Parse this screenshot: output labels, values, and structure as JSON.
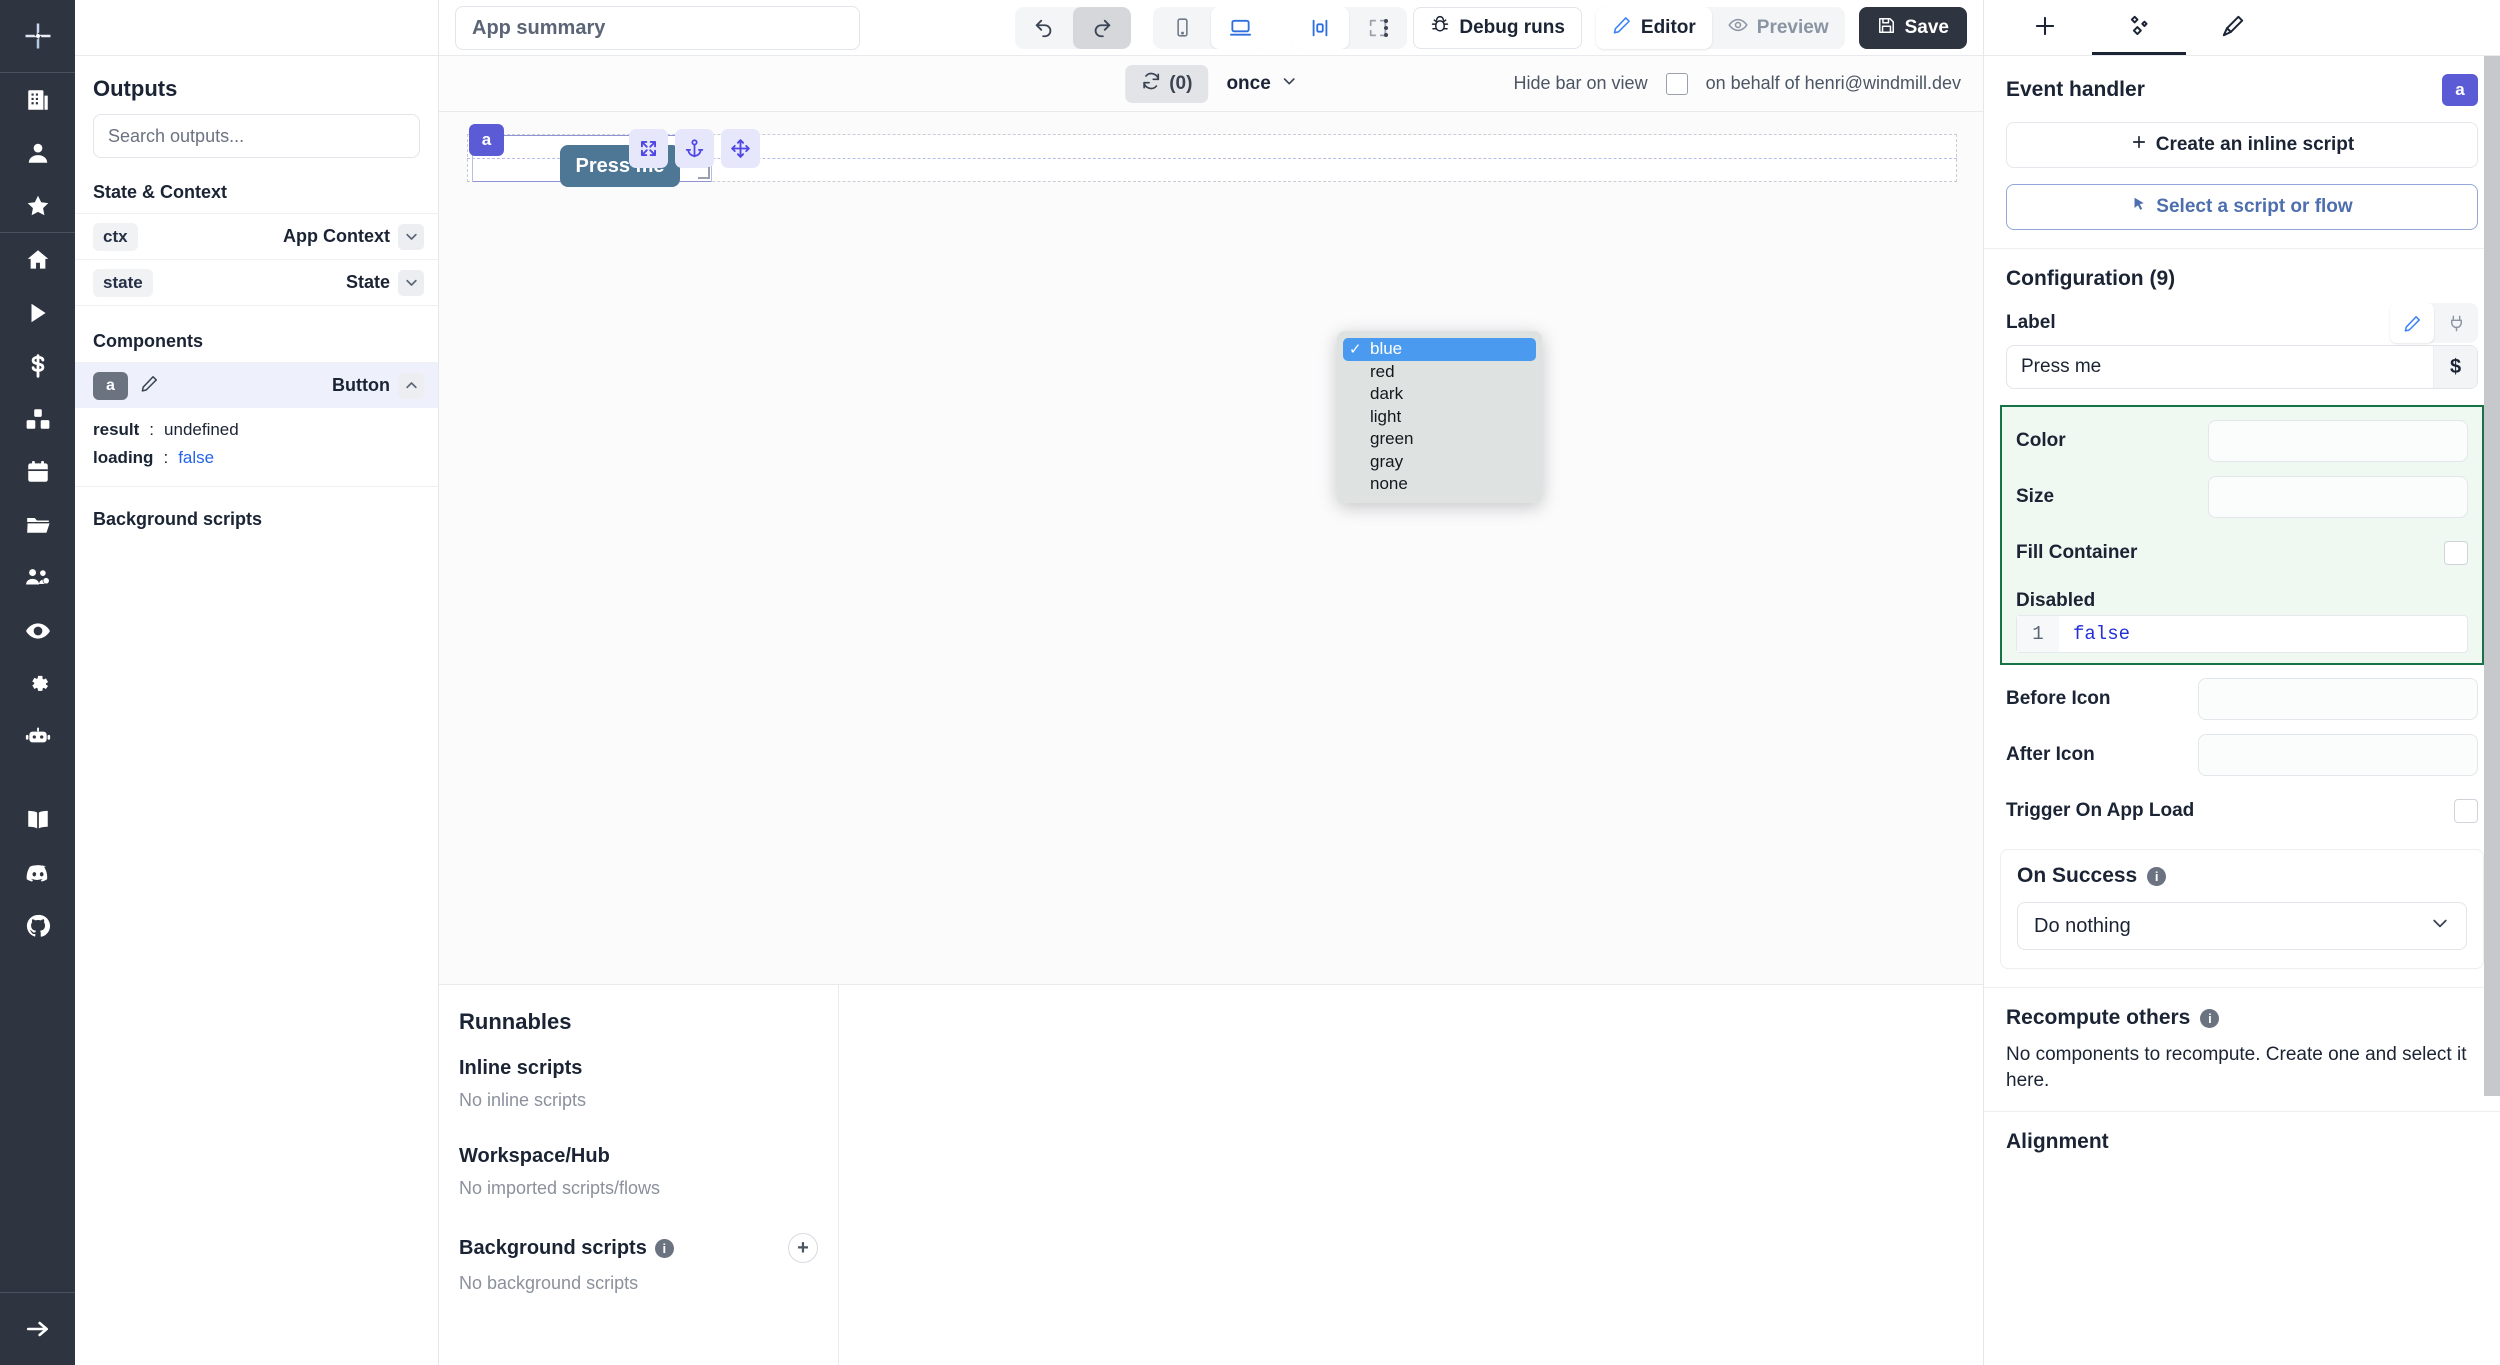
{
  "header": {
    "app_summary_placeholder": "App summary",
    "undo_icon": "undo-icon",
    "redo_icon": "redo-icon",
    "mobile_icon": "mobile-view-icon",
    "desktop_icon": "desktop-view-icon",
    "center_icon": "center-align-icon",
    "expand_icon": "expand-icon",
    "kebab_icon": "more-options-icon",
    "debug_runs_label": "Debug runs",
    "debug_icon": "bug-icon",
    "editor_label": "Editor",
    "editor_icon": "pencil-icon",
    "preview_label": "Preview",
    "preview_icon": "eye-icon",
    "save_label": "Save",
    "save_icon": "floppy-disk-icon"
  },
  "rail": {
    "logo": "windmill-logo",
    "items": [
      {
        "icon": "building-icon"
      },
      {
        "icon": "user-icon"
      },
      {
        "icon": "star-icon"
      },
      {
        "icon": "home-icon"
      },
      {
        "icon": "play-icon"
      },
      {
        "icon": "dollar-icon"
      },
      {
        "icon": "boxes-icon"
      },
      {
        "icon": "calendar-icon"
      },
      {
        "icon": "folder-icon"
      },
      {
        "icon": "team-settings-icon"
      },
      {
        "icon": "eye-icon"
      },
      {
        "icon": "gear-icon"
      },
      {
        "icon": "robot-icon"
      },
      {
        "icon": "book-icon"
      },
      {
        "icon": "discord-icon"
      },
      {
        "icon": "github-icon"
      },
      {
        "icon": "arrow-right-icon"
      }
    ]
  },
  "outputs": {
    "title": "Outputs",
    "search_placeholder": "Search outputs...",
    "state_context_heading": "State & Context",
    "state_rows": [
      {
        "id": "ctx",
        "type": "App Context"
      },
      {
        "id": "state",
        "type": "State"
      }
    ],
    "components_heading": "Components",
    "component": {
      "id": "a",
      "type": "Button",
      "edit_icon": "pencil-icon",
      "collapse_icon": "chevron-up-icon",
      "fields": [
        {
          "key": "result",
          "sep": ":",
          "value": "undefined",
          "kind": "plain"
        },
        {
          "key": "loading",
          "sep": ":",
          "value": "false",
          "kind": "bool"
        }
      ]
    },
    "background_scripts_heading": "Background scripts"
  },
  "canvas_toolbar": {
    "refresh_icon": "refresh-icon",
    "refresh_count": "(0)",
    "frequency": "once",
    "chevron_icon": "chevron-down-icon",
    "hide_bar_label": "Hide bar on view",
    "on_behalf_label": "on behalf of henri@windmill.dev"
  },
  "canvas": {
    "component_tag": "a",
    "button_label": "Press me",
    "handles": [
      {
        "icon": "expand-component-icon"
      },
      {
        "icon": "anchor-icon"
      },
      {
        "icon": "move-icon"
      }
    ],
    "resize_icon": "resize-corner-icon"
  },
  "runnables": {
    "title": "Runnables",
    "groups": [
      {
        "heading": "Inline scripts",
        "empty": "No inline scripts",
        "info": false,
        "add": false
      },
      {
        "heading": "Workspace/Hub",
        "empty": "No imported scripts/flows",
        "info": false,
        "add": false
      },
      {
        "heading": "Background scripts",
        "empty": "No background scripts",
        "info": true,
        "add": true
      }
    ],
    "info_icon": "info-icon",
    "add_icon": "plus-icon"
  },
  "right_panel": {
    "tabs": [
      {
        "icon": "plus-icon",
        "active": false,
        "name": "add-component-tab"
      },
      {
        "icon": "component-settings-icon",
        "active": true,
        "name": "settings-tab"
      },
      {
        "icon": "styling-brush-icon",
        "active": false,
        "name": "styling-tab"
      }
    ],
    "event_handler": {
      "title": "Event handler",
      "badge": "a",
      "create_inline_label": "Create an inline script",
      "create_inline_icon": "plus-icon",
      "select_script_label": "Select a script or flow",
      "select_script_icon": "cursor-icon"
    },
    "configuration": {
      "title": "Configuration (9)",
      "label_field": {
        "label": "Label",
        "value": "Press me",
        "dollar_icon": "dollar-icon",
        "pencil_icon": "pencil-icon",
        "plug_icon": "plug-icon"
      },
      "highlighted_fields": [
        {
          "label": "Color",
          "control": "select"
        },
        {
          "label": "Size",
          "control": "select"
        },
        {
          "label": "Fill Container",
          "control": "checkbox"
        },
        {
          "label": "Disabled",
          "control": "code",
          "line_no": "1",
          "code": "false"
        }
      ],
      "color_dropdown": {
        "options": [
          "blue",
          "red",
          "dark",
          "light",
          "green",
          "gray",
          "none"
        ],
        "selected": "blue",
        "check_glyph": "✓"
      },
      "other_fields": [
        {
          "label": "Before Icon",
          "control": "input"
        },
        {
          "label": "After Icon",
          "control": "input"
        },
        {
          "label": "Trigger On App Load",
          "control": "checkbox"
        }
      ]
    },
    "on_success": {
      "title": "On Success",
      "info_icon": "info-icon",
      "value": "Do nothing",
      "chevron_icon": "chevron-down-icon"
    },
    "recompute_others": {
      "title": "Recompute others",
      "info_icon": "info-icon",
      "text": "No components to recompute. Create one and select it here."
    },
    "alignment": {
      "title": "Alignment"
    }
  },
  "colors": {
    "accent_indigo": "#5b5bd6",
    "dark_navy": "#2e3440",
    "highlight_green": "#177245",
    "select_blue": "#4a9bf0",
    "button_blue": "#4e7695",
    "link_blue": "#2563eb"
  }
}
